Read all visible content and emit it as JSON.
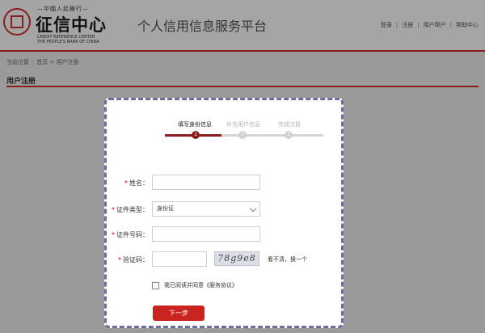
{
  "header": {
    "logo_top": "—中國人民銀行—",
    "logo_main": "征信中心",
    "logo_en_1": "CREDIT REFERENCE CENTER",
    "logo_en_2": "THE PEOPLE'S BANK OF CHINA",
    "site_title": "个人信用信息服务平台",
    "nav": [
      "登录",
      "注册",
      "用户帮户",
      "帮助中心"
    ],
    "nav_separator": "|"
  },
  "breadcrumb": "当前位置 ：首页 > 用户注册",
  "section_title": "用户注册",
  "steps": [
    {
      "label": "填写身份信息",
      "number": "1",
      "active": true
    },
    {
      "label": "补充用户信息",
      "number": "2",
      "active": false
    },
    {
      "label": "完成注册",
      "number": "3",
      "active": false
    }
  ],
  "form": {
    "name_label": "姓名：",
    "name_value": "",
    "id_type_label": "证件类型：",
    "id_type_value": "身份证",
    "id_number_label": "证件号码：",
    "id_number_value": "",
    "captcha_label": "验证码：",
    "captcha_value": "",
    "captcha_image_text": "78g9e8",
    "captcha_refresh": "看不清，换一个",
    "required_mark": "*",
    "agree_text": "我已阅读并同意《服务协议》",
    "next_button": "下一步"
  },
  "colors": {
    "brand_red": "#8a1d1d",
    "button_red": "#c9241f",
    "card_border": "#6c6f9e"
  }
}
